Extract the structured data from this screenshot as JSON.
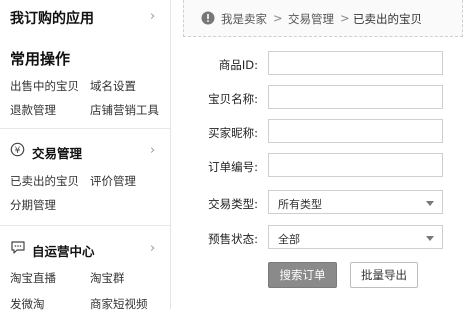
{
  "sidebar": {
    "my_apps_title": "我订购的应用",
    "common_ops": {
      "title": "常用操作",
      "items": [
        "出售中的宝贝",
        "域名设置",
        "退款管理",
        "店铺营销工具"
      ]
    },
    "trade_mgmt": {
      "title": "交易管理",
      "icon": "currency-icon",
      "items": [
        "已卖出的宝贝",
        "评价管理",
        "分期管理"
      ]
    },
    "self_op": {
      "title": "自运营中心",
      "icon": "chat-bubble-icon",
      "items": [
        "淘宝直播",
        "淘宝群",
        "发微淘",
        "商家短视频"
      ]
    }
  },
  "breadcrumb": {
    "icon": "info-icon",
    "items": [
      "我是卖家",
      "交易管理",
      "已卖出的宝贝"
    ],
    "separator": ">"
  },
  "form": {
    "product_id_label": "商品ID:",
    "product_name_label": "宝贝名称:",
    "buyer_nick_label": "买家昵称:",
    "order_no_label": "订单编号:",
    "trade_type_label": "交易类型:",
    "trade_type_value": "所有类型",
    "presale_status_label": "预售状态:",
    "presale_status_value": "全部"
  },
  "buttons": {
    "search": "搜索订单",
    "batch_export": "批量导出"
  }
}
